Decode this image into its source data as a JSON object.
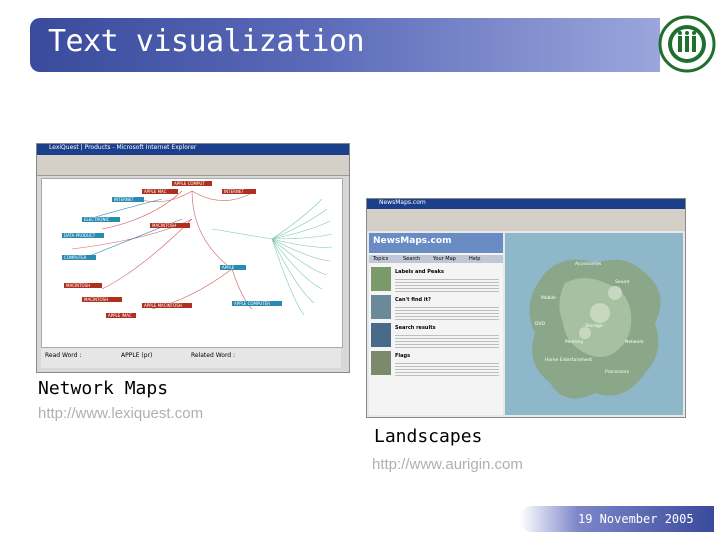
{
  "slide": {
    "title": "Text visualization",
    "date": "19 November 2005"
  },
  "colors": {
    "banner_dark": "#3a4a9c",
    "banner_light": "#9aa6dc",
    "logo_green": "#1f6f2f",
    "url_gray": "#b0b0b0"
  },
  "network_maps": {
    "caption": "Network Maps",
    "url": "http://www.lexiquest.com",
    "window_title": "LexiQuest | Products - Microsoft Internet Explorer",
    "left_label": "Read Word :",
    "left_value": "APPLE (pr)",
    "right_label": "Related Word :",
    "nodes": {
      "n1": "APPLE COMPUT",
      "n2": "APPLE MAC",
      "n3": "INTERNET",
      "n4": "ELECTRONIC",
      "n5": "DATA PRODUCT",
      "n6": "COMPUTER",
      "n7": "MACINTOSH",
      "n8": "APPLE",
      "n9": "APPLE COMPUTER",
      "n10": "APPLE MACINTOSH",
      "n11": "MACINTOSH",
      "n12": "APPLE IMAC"
    }
  },
  "landscapes": {
    "caption": "Landscapes",
    "url": "http://www.aurigin.com",
    "window_title": "NewsMaps.com",
    "app_name": "NewsMaps.com",
    "tabs": [
      "Topics",
      "Search",
      "Your Map",
      "Help"
    ],
    "sections": {
      "s1": "Labels and Peaks",
      "s2": "Can't find it?",
      "s3": "Search results",
      "s4": "Flags"
    },
    "regions": {
      "r1": "Accessories",
      "r2": "Sound",
      "r3": "Mobile",
      "r4": "DVD",
      "r5": "Storage",
      "r6": "Network",
      "r7": "Home Entertainment",
      "r8": "Memory",
      "r9": "Processors"
    }
  }
}
